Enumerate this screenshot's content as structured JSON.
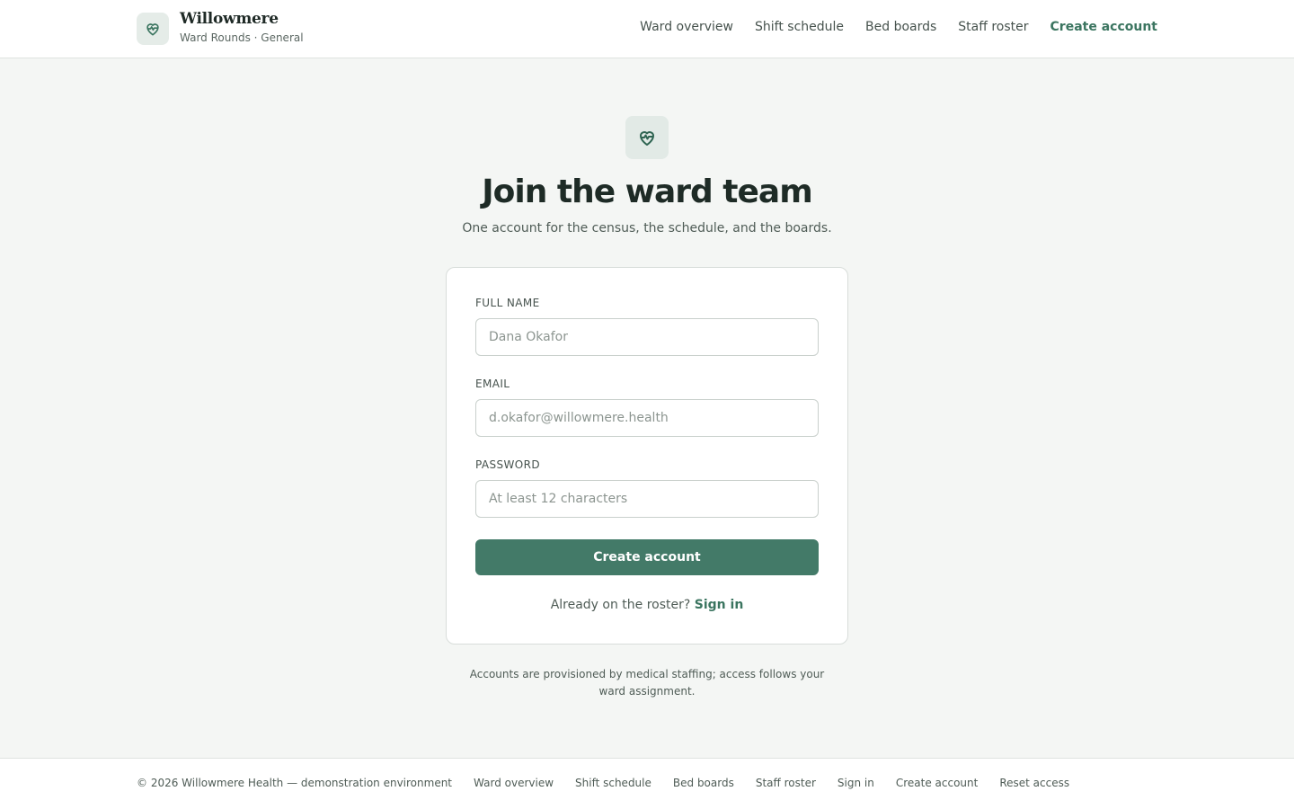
{
  "brand": {
    "name": "Willowmere",
    "subtitle": "Ward Rounds · General",
    "logo_icon": "heart-pulse-icon",
    "accent_color": "#437a68"
  },
  "nav": {
    "items": [
      {
        "label": "Ward overview"
      },
      {
        "label": "Shift schedule"
      },
      {
        "label": "Bed boards"
      },
      {
        "label": "Staff roster"
      },
      {
        "label": "Create account",
        "active": true
      }
    ]
  },
  "hero": {
    "icon": "heart-pulse-icon",
    "title": "Join the ward team",
    "subtitle": "One account for the census, the schedule, and the boards."
  },
  "form": {
    "full_name": {
      "label": "FULL NAME",
      "value": "",
      "placeholder": "Dana Okafor"
    },
    "email": {
      "label": "EMAIL",
      "value": "",
      "placeholder": "d.okafor@willowmere.health"
    },
    "password": {
      "label": "PASSWORD",
      "value": "",
      "placeholder": "At least 12 characters"
    },
    "submit_label": "Create account",
    "signin_prompt": "Already on the roster?",
    "signin_link": "Sign in"
  },
  "note": "Accounts are provisioned by medical staffing; access follows your ward assignment.",
  "footer": {
    "copyright": "© 2026 Willowmere Health — demonstration environment",
    "links": [
      {
        "label": "Ward overview"
      },
      {
        "label": "Shift schedule"
      },
      {
        "label": "Bed boards"
      },
      {
        "label": "Staff roster"
      },
      {
        "label": "Sign in"
      },
      {
        "label": "Create account"
      },
      {
        "label": "Reset access"
      }
    ]
  }
}
